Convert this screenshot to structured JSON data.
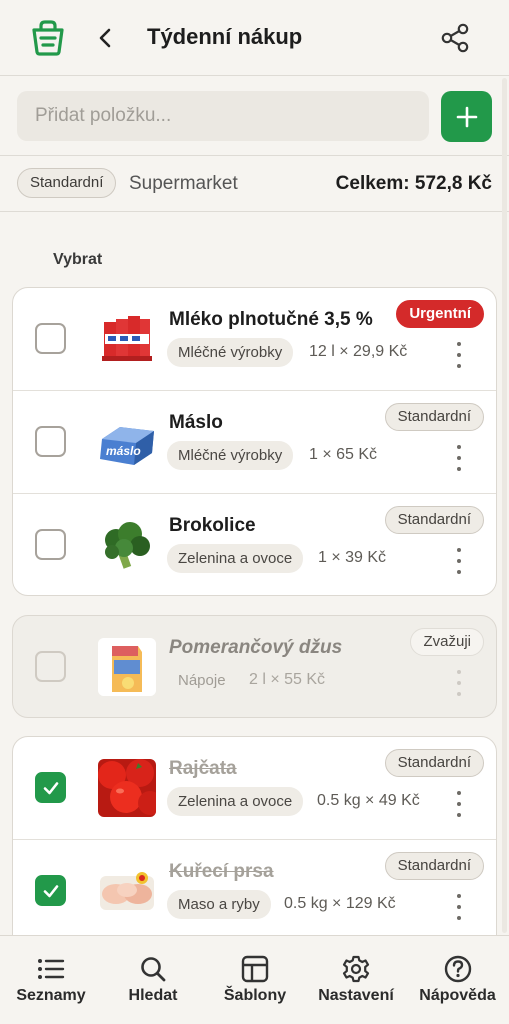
{
  "app": {
    "accent": "#22994a"
  },
  "header": {
    "title": "Týdenní nákup",
    "logo_icon": "shopping-basket-icon",
    "back_icon": "chevron-left-icon",
    "share_icon": "share-icon"
  },
  "add": {
    "placeholder": "Přidat položku...",
    "button_icon": "plus-icon"
  },
  "meta": {
    "priority_chip": "Standardní",
    "store": "Supermarket",
    "total": "Celkem: 572,8 Kč"
  },
  "select_label": "Vybrat",
  "groups": [
    {
      "items": [
        {
          "name": "Mléko plnotučné 3,5 %",
          "category": "Mléčné výrobky",
          "quantity": "12 l × 29,9 Kč",
          "priority": "Urgentní",
          "checked": false
        },
        {
          "name": "Máslo",
          "category": "Mléčné výrobky",
          "quantity": "1 × 65 Kč",
          "priority": "Standardní",
          "checked": false
        },
        {
          "name": "Brokolice",
          "category": "Zelenina a ovoce",
          "quantity": "1 × 39 Kč",
          "priority": "Standardní",
          "checked": false
        }
      ]
    },
    {
      "items": [
        {
          "name": "Pomerančový džus",
          "category": "Nápoje",
          "quantity": "2 l × 55 Kč",
          "priority": "Zvažuji",
          "checked": false
        }
      ]
    },
    {
      "items": [
        {
          "name": "Rajčata",
          "category": "Zelenina a ovoce",
          "quantity": "0.5 kg × 49 Kč",
          "priority": "Standardní",
          "checked": true
        },
        {
          "name": "Kuřecí prsa",
          "category": "Maso a ryby",
          "quantity": "0.5 kg × 129 Kč",
          "priority": "Standardní",
          "checked": true
        }
      ]
    }
  ],
  "nav": [
    {
      "label": "Seznamy",
      "icon": "list-icon"
    },
    {
      "label": "Hledat",
      "icon": "search-icon"
    },
    {
      "label": "Šablony",
      "icon": "template-icon"
    },
    {
      "label": "Nastavení",
      "icon": "gear-icon"
    },
    {
      "label": "Nápověda",
      "icon": "help-icon"
    }
  ]
}
